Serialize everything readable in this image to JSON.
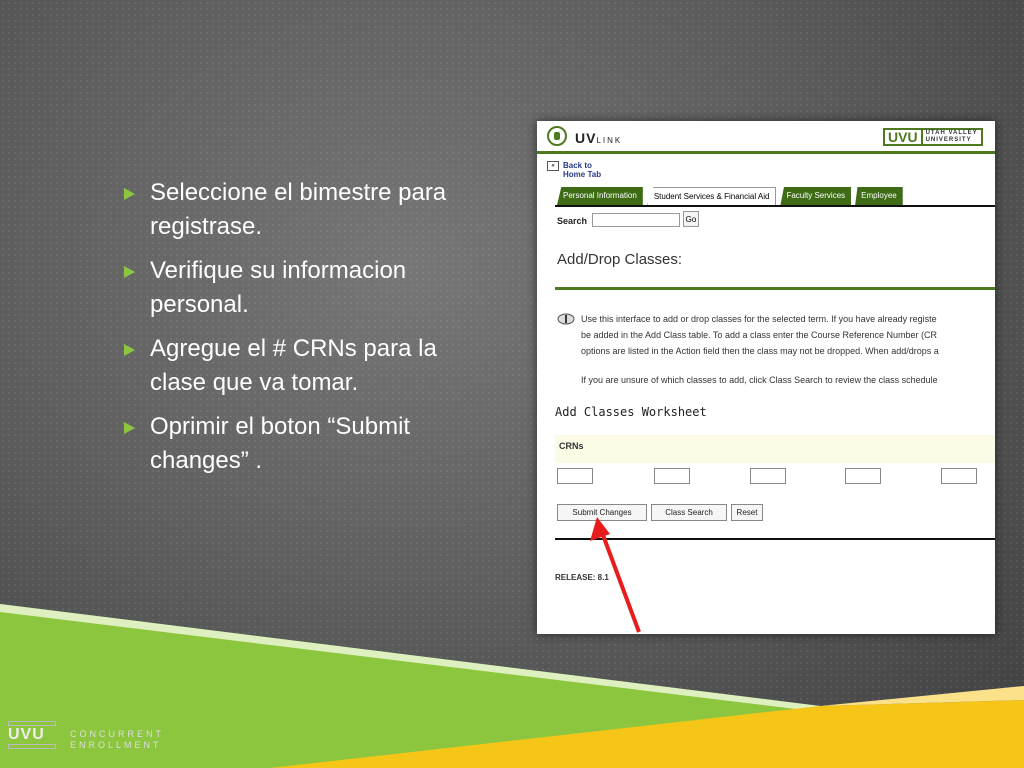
{
  "slide": {
    "bullets": [
      "Seleccione el bimestre para registrase.",
      "Verifique su informacion personal.",
      "Agregue el # CRNs para la clase que va tomar.",
      "Oprimir el boton “Submit changes” ."
    ],
    "footer": {
      "logo_text": "UVU",
      "line1": "CONCURRENT",
      "line2": "ENROLLMENT"
    },
    "colors": {
      "accent_green": "#8cc63f",
      "accent_yellow": "#f5c518",
      "background": "#5f5f5f",
      "arrow": "#e81c1c"
    }
  },
  "screenshot": {
    "brand": "UV",
    "brand_small": "LINK",
    "university_logo": "UVU",
    "university_line1": "UTAH VALLEY",
    "university_line2": "UNIVERSITY",
    "back_line1": "Back to",
    "back_line2": "Home Tab",
    "back_icon": "«",
    "tabs": [
      "Personal Information",
      "Student Services & Financial Aid",
      "Faculty Services",
      "Employee"
    ],
    "search_label": "Search",
    "search_value": "",
    "go_label": "Go",
    "page_title": "Add/Drop Classes:",
    "info_lines": [
      "Use this interface to add or drop classes for the selected term. If you have already registe",
      "be added in the Add Class table. To add a class enter the Course Reference Number (CR",
      "options are listed in the Action field then the class may not be dropped. When add/drops a"
    ],
    "info_line4": "If you are unsure of which classes to add, click Class Search to review the class schedule",
    "worksheet_title": "Add Classes Worksheet",
    "crn_label": "CRNs",
    "buttons": {
      "submit": "Submit Changes",
      "class_search": "Class Search",
      "reset": "Reset"
    },
    "release": "RELEASE: 8.1"
  }
}
